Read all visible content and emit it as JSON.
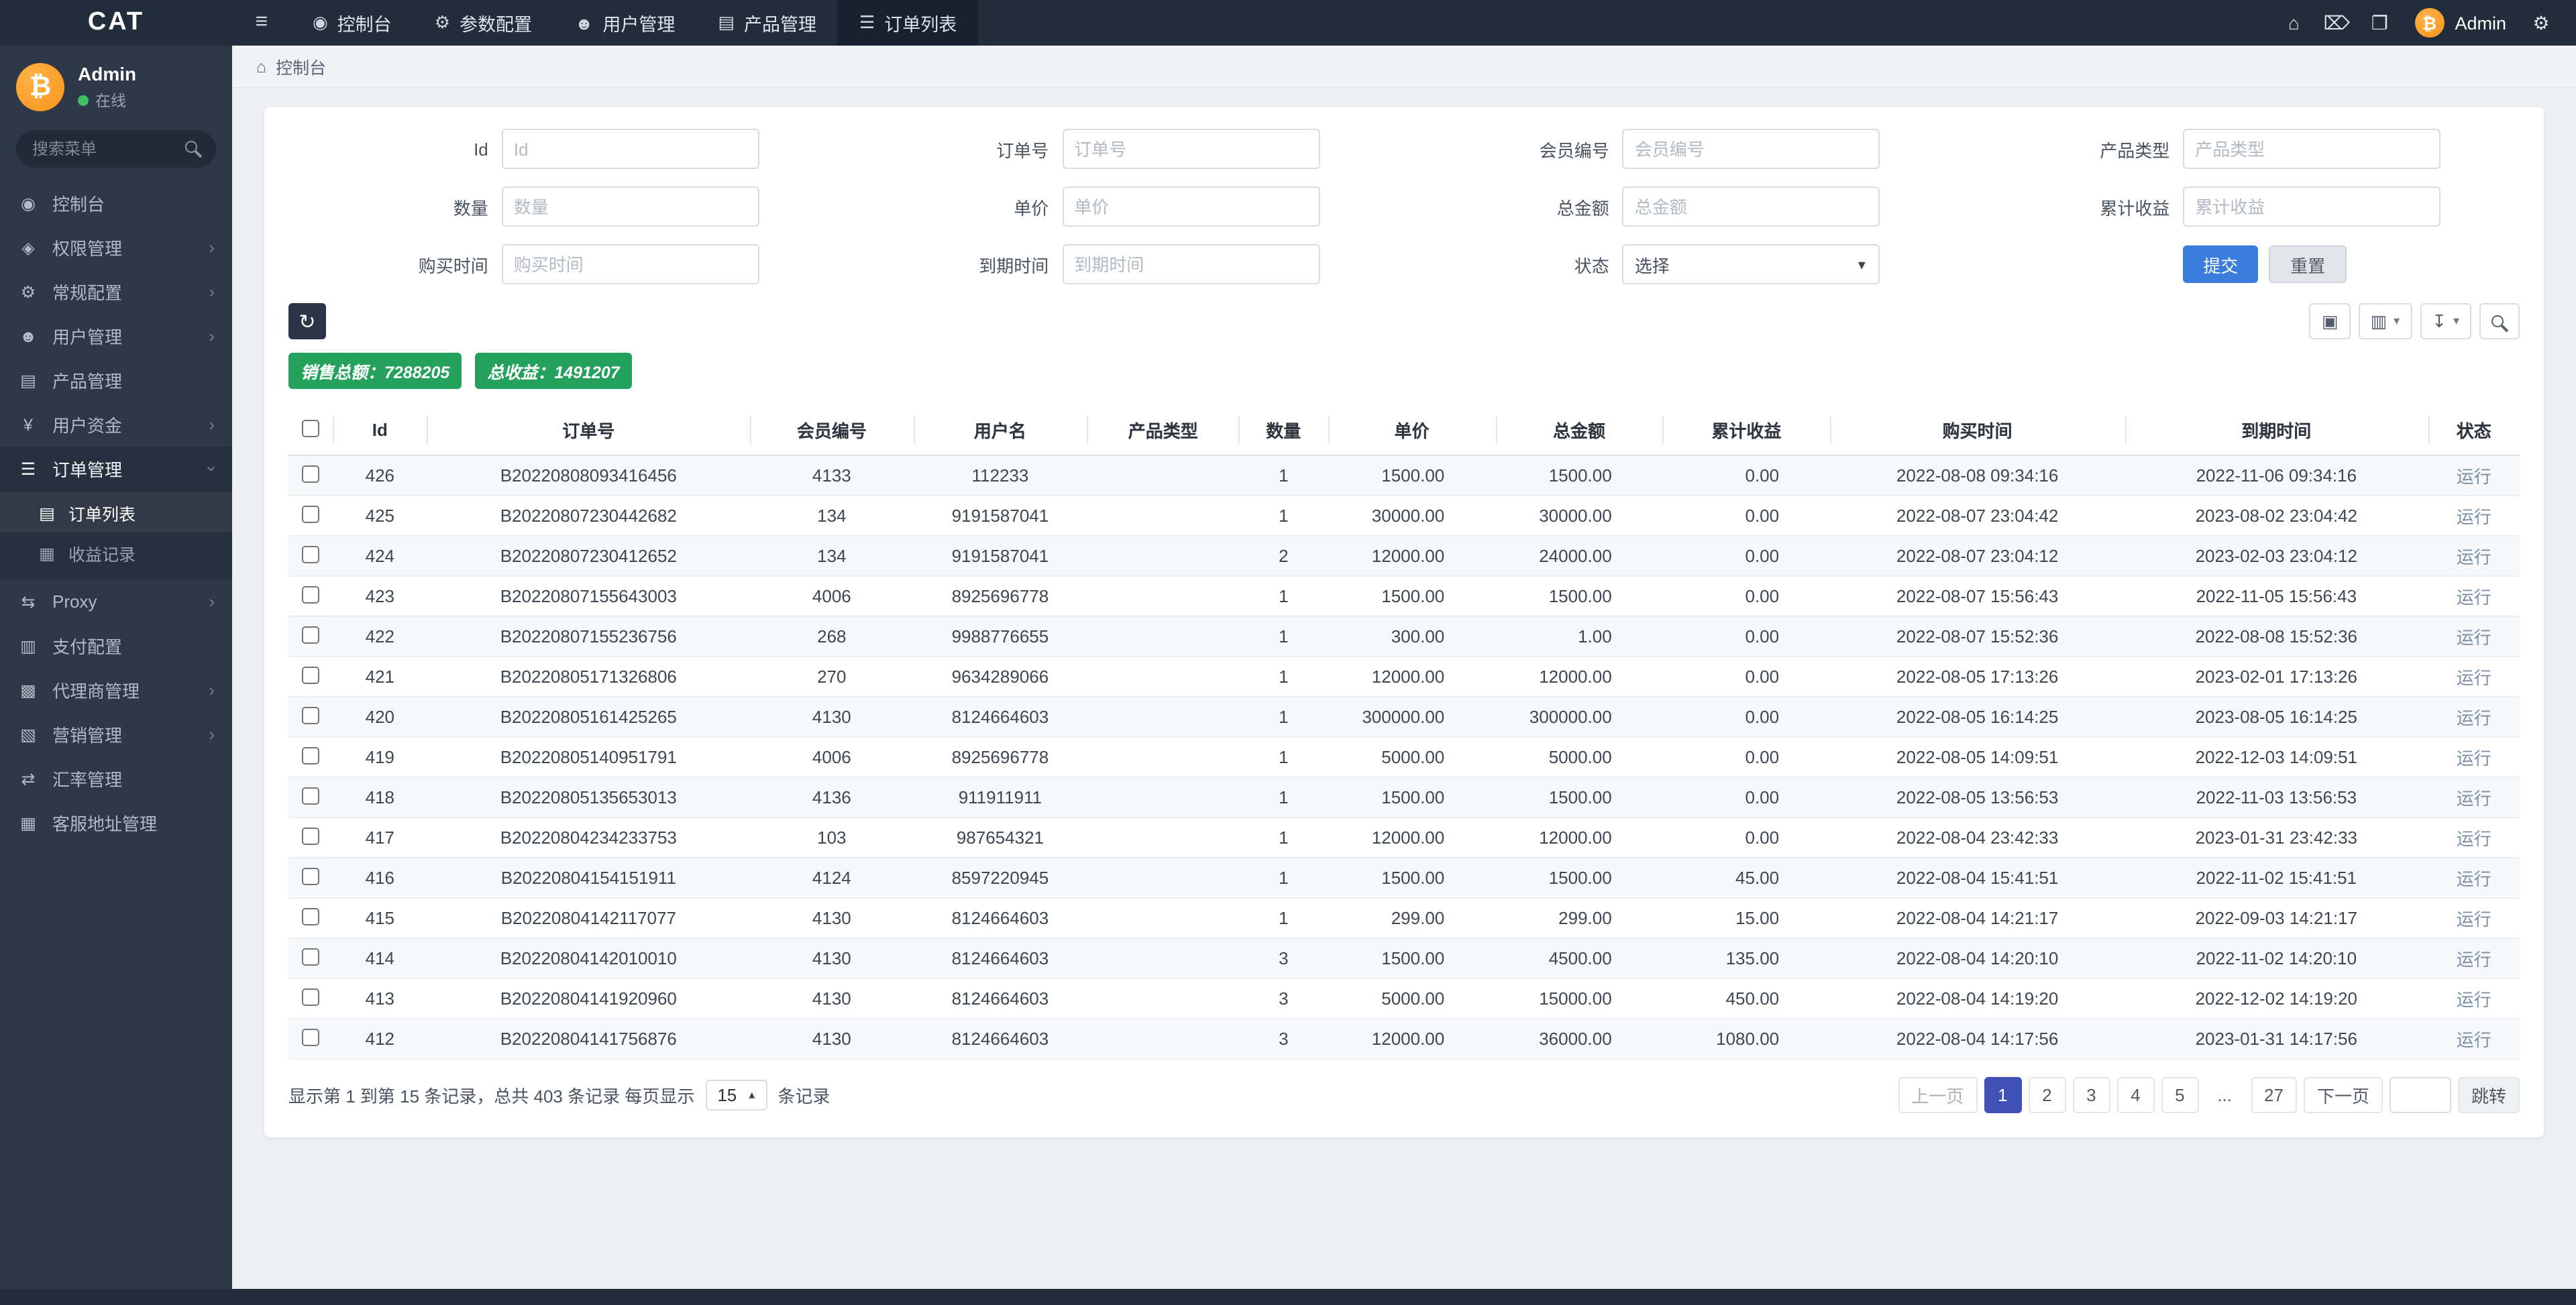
{
  "icons": {
    "chevron_right": "›",
    "chevron_down": "▾",
    "caret_up": "▴"
  },
  "navbar": {
    "brand": "CAT",
    "toggle_glyph": "≡",
    "items": [
      {
        "key": "dashboard",
        "glyph": "◉",
        "label": "控制台",
        "active": false
      },
      {
        "key": "params-config",
        "glyph": "⚙",
        "label": "参数配置",
        "active": false
      },
      {
        "key": "user-mgmt",
        "glyph": "☻",
        "label": "用户管理",
        "active": false
      },
      {
        "key": "product-mgmt",
        "glyph": "▤",
        "label": "产品管理",
        "active": false
      },
      {
        "key": "order-list",
        "glyph": "☰",
        "label": "订单列表",
        "active": true
      }
    ],
    "right": {
      "icons": [
        {
          "key": "home",
          "glyph": "⌂"
        },
        {
          "key": "trash",
          "glyph": "⌦"
        },
        {
          "key": "fullscreen",
          "glyph": "❐"
        }
      ],
      "username": "Admin",
      "avatar_glyph": "₿",
      "settings_glyph": "⚙"
    }
  },
  "sidebar": {
    "user": {
      "name": "Admin",
      "status": "在线",
      "avatar_glyph": "₿"
    },
    "search_placeholder": "搜索菜单",
    "items": [
      {
        "key": "dashboard",
        "glyph": "◉",
        "label": "控制台"
      },
      {
        "key": "permission-mgmt",
        "glyph": "◈",
        "label": "权限管理",
        "chevron": true
      },
      {
        "key": "general-config",
        "glyph": "⚙",
        "label": "常规配置",
        "chevron": true
      },
      {
        "key": "user-mgmt",
        "glyph": "☻",
        "label": "用户管理",
        "chevron": true
      },
      {
        "key": "product-mgmt",
        "glyph": "▤",
        "label": "产品管理"
      },
      {
        "key": "user-funds",
        "glyph": "¥",
        "label": "用户资金",
        "chevron": true
      },
      {
        "key": "order-mgmt",
        "glyph": "☰",
        "label": "订单管理",
        "chevron": true,
        "open": true,
        "active": true,
        "children": [
          {
            "key": "order-list",
            "glyph": "▤",
            "label": "订单列表",
            "active": true
          },
          {
            "key": "profit-records",
            "glyph": "▦",
            "label": "收益记录"
          }
        ]
      },
      {
        "key": "proxy",
        "glyph": "⇆",
        "label": "Proxy",
        "chevron": true
      },
      {
        "key": "payment-config",
        "glyph": "▥",
        "label": "支付配置"
      },
      {
        "key": "agent-mgmt",
        "glyph": "▩",
        "label": "代理商管理",
        "chevron": true
      },
      {
        "key": "marketing-mgmt",
        "glyph": "▧",
        "label": "营销管理",
        "chevron": true
      },
      {
        "key": "exchange-rate-mgmt",
        "glyph": "⇄",
        "label": "汇率管理"
      },
      {
        "key": "service-address-mgmt",
        "glyph": "▦",
        "label": "客服地址管理"
      }
    ]
  },
  "breadcrumb": {
    "glyph": "⌂",
    "label": "控制台"
  },
  "filters": {
    "fields": [
      {
        "key": "id",
        "label": "Id",
        "placeholder": "Id",
        "type": "text"
      },
      {
        "key": "order-no",
        "label": "订单号",
        "placeholder": "订单号",
        "type": "text"
      },
      {
        "key": "member-no",
        "label": "会员编号",
        "placeholder": "会员编号",
        "type": "text"
      },
      {
        "key": "product-type",
        "label": "产品类型",
        "placeholder": "产品类型",
        "type": "text"
      },
      {
        "key": "quantity",
        "label": "数量",
        "placeholder": "数量",
        "type": "text"
      },
      {
        "key": "unit-price",
        "label": "单价",
        "placeholder": "单价",
        "type": "text"
      },
      {
        "key": "total-amount",
        "label": "总金额",
        "placeholder": "总金额",
        "type": "text"
      },
      {
        "key": "accum-profit",
        "label": "累计收益",
        "placeholder": "累计收益",
        "type": "text"
      },
      {
        "key": "buy-time",
        "label": "购买时间",
        "placeholder": "购买时间",
        "type": "text"
      },
      {
        "key": "expire-time",
        "label": "到期时间",
        "placeholder": "到期时间",
        "type": "text"
      },
      {
        "key": "status",
        "label": "状态",
        "value": "选择",
        "type": "select"
      }
    ],
    "submit_label": "提交",
    "reset_label": "重置"
  },
  "stats": {
    "sales_total": "销售总额：7288205",
    "profit_total": "总收益：1491207"
  },
  "toolbar": {
    "refresh_glyph": "↻",
    "buttons": [
      {
        "key": "detail-view",
        "glyph": "▣"
      },
      {
        "key": "columns",
        "glyph": "▥",
        "caret": true
      },
      {
        "key": "export",
        "glyph": "↧",
        "caret": true
      },
      {
        "key": "search",
        "glyph": "mag"
      }
    ]
  },
  "table": {
    "columns": [
      "Id",
      "订单号",
      "会员编号",
      "用户名",
      "产品类型",
      "数量",
      "单价",
      "总金额",
      "累计收益",
      "购买时间",
      "到期时间",
      "状态"
    ],
    "field_order": [
      "id",
      "order_no",
      "member_no",
      "username",
      "product_type",
      "qty",
      "unit_price",
      "total_amount",
      "accum_profit",
      "buy_time",
      "expire_time",
      "status"
    ],
    "rows": [
      {
        "id": "426",
        "order_no": "B20220808093416456",
        "member_no": "4133",
        "username": "112233",
        "product_type": "",
        "qty": "1",
        "unit_price": "1500.00",
        "total_amount": "1500.00",
        "accum_profit": "0.00",
        "buy_time": "2022-08-08 09:34:16",
        "expire_time": "2022-11-06 09:34:16",
        "status": "运行"
      },
      {
        "id": "425",
        "order_no": "B20220807230442682",
        "member_no": "134",
        "username": "9191587041",
        "product_type": "",
        "qty": "1",
        "unit_price": "30000.00",
        "total_amount": "30000.00",
        "accum_profit": "0.00",
        "buy_time": "2022-08-07 23:04:42",
        "expire_time": "2023-08-02 23:04:42",
        "status": "运行"
      },
      {
        "id": "424",
        "order_no": "B20220807230412652",
        "member_no": "134",
        "username": "9191587041",
        "product_type": "",
        "qty": "2",
        "unit_price": "12000.00",
        "total_amount": "24000.00",
        "accum_profit": "0.00",
        "buy_time": "2022-08-07 23:04:12",
        "expire_time": "2023-02-03 23:04:12",
        "status": "运行"
      },
      {
        "id": "423",
        "order_no": "B20220807155643003",
        "member_no": "4006",
        "username": "8925696778",
        "product_type": "",
        "qty": "1",
        "unit_price": "1500.00",
        "total_amount": "1500.00",
        "accum_profit": "0.00",
        "buy_time": "2022-08-07 15:56:43",
        "expire_time": "2022-11-05 15:56:43",
        "status": "运行"
      },
      {
        "id": "422",
        "order_no": "B20220807155236756",
        "member_no": "268",
        "username": "9988776655",
        "product_type": "",
        "qty": "1",
        "unit_price": "300.00",
        "total_amount": "1.00",
        "accum_profit": "0.00",
        "buy_time": "2022-08-07 15:52:36",
        "expire_time": "2022-08-08 15:52:36",
        "status": "运行"
      },
      {
        "id": "421",
        "order_no": "B20220805171326806",
        "member_no": "270",
        "username": "9634289066",
        "product_type": "",
        "qty": "1",
        "unit_price": "12000.00",
        "total_amount": "12000.00",
        "accum_profit": "0.00",
        "buy_time": "2022-08-05 17:13:26",
        "expire_time": "2023-02-01 17:13:26",
        "status": "运行"
      },
      {
        "id": "420",
        "order_no": "B20220805161425265",
        "member_no": "4130",
        "username": "8124664603",
        "product_type": "",
        "qty": "1",
        "unit_price": "300000.00",
        "total_amount": "300000.00",
        "accum_profit": "0.00",
        "buy_time": "2022-08-05 16:14:25",
        "expire_time": "2023-08-05 16:14:25",
        "status": "运行"
      },
      {
        "id": "419",
        "order_no": "B20220805140951791",
        "member_no": "4006",
        "username": "8925696778",
        "product_type": "",
        "qty": "1",
        "unit_price": "5000.00",
        "total_amount": "5000.00",
        "accum_profit": "0.00",
        "buy_time": "2022-08-05 14:09:51",
        "expire_time": "2022-12-03 14:09:51",
        "status": "运行"
      },
      {
        "id": "418",
        "order_no": "B20220805135653013",
        "member_no": "4136",
        "username": "911911911",
        "product_type": "",
        "qty": "1",
        "unit_price": "1500.00",
        "total_amount": "1500.00",
        "accum_profit": "0.00",
        "buy_time": "2022-08-05 13:56:53",
        "expire_time": "2022-11-03 13:56:53",
        "status": "运行"
      },
      {
        "id": "417",
        "order_no": "B20220804234233753",
        "member_no": "103",
        "username": "987654321",
        "product_type": "",
        "qty": "1",
        "unit_price": "12000.00",
        "total_amount": "12000.00",
        "accum_profit": "0.00",
        "buy_time": "2022-08-04 23:42:33",
        "expire_time": "2023-01-31 23:42:33",
        "status": "运行"
      },
      {
        "id": "416",
        "order_no": "B20220804154151911",
        "member_no": "4124",
        "username": "8597220945",
        "product_type": "",
        "qty": "1",
        "unit_price": "1500.00",
        "total_amount": "1500.00",
        "accum_profit": "45.00",
        "buy_time": "2022-08-04 15:41:51",
        "expire_time": "2022-11-02 15:41:51",
        "status": "运行"
      },
      {
        "id": "415",
        "order_no": "B20220804142117077",
        "member_no": "4130",
        "username": "8124664603",
        "product_type": "",
        "qty": "1",
        "unit_price": "299.00",
        "total_amount": "299.00",
        "accum_profit": "15.00",
        "buy_time": "2022-08-04 14:21:17",
        "expire_time": "2022-09-03 14:21:17",
        "status": "运行"
      },
      {
        "id": "414",
        "order_no": "B20220804142010010",
        "member_no": "4130",
        "username": "8124664603",
        "product_type": "",
        "qty": "3",
        "unit_price": "1500.00",
        "total_amount": "4500.00",
        "accum_profit": "135.00",
        "buy_time": "2022-08-04 14:20:10",
        "expire_time": "2022-11-02 14:20:10",
        "status": "运行"
      },
      {
        "id": "413",
        "order_no": "B20220804141920960",
        "member_no": "4130",
        "username": "8124664603",
        "product_type": "",
        "qty": "3",
        "unit_price": "5000.00",
        "total_amount": "15000.00",
        "accum_profit": "450.00",
        "buy_time": "2022-08-04 14:19:20",
        "expire_time": "2022-12-02 14:19:20",
        "status": "运行"
      },
      {
        "id": "412",
        "order_no": "B20220804141756876",
        "member_no": "4130",
        "username": "8124664603",
        "product_type": "",
        "qty": "3",
        "unit_price": "12000.00",
        "total_amount": "36000.00",
        "accum_profit": "1080.00",
        "buy_time": "2022-08-04 14:17:56",
        "expire_time": "2023-01-31 14:17:56",
        "status": "运行"
      }
    ]
  },
  "footer": {
    "summary_prefix": "显示第 1 到第 15 条记录，总共 403 条记录 每页显示",
    "page_size": "15",
    "summary_suffix": "条记录",
    "pagination": {
      "prev": "上一页",
      "pages": [
        "1",
        "2",
        "3",
        "4",
        "5",
        "...",
        "27"
      ],
      "active": "1",
      "next": "下一页",
      "jump": "跳转"
    }
  }
}
